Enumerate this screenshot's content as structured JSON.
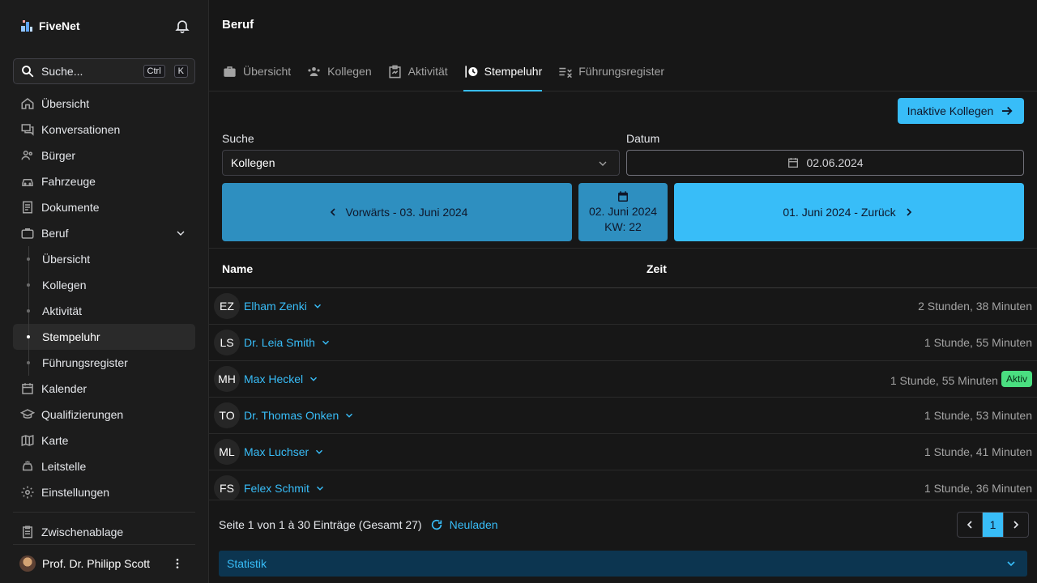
{
  "brand": {
    "name": "FiveNet"
  },
  "search": {
    "placeholder": "Suche...",
    "kbd1": "Ctrl",
    "kbd2": "K"
  },
  "sidebar": {
    "items": [
      {
        "label": "Übersicht",
        "icon": "home-icon"
      },
      {
        "label": "Konversationen",
        "icon": "chat-icon"
      },
      {
        "label": "Bürger",
        "icon": "users-icon"
      },
      {
        "label": "Fahrzeuge",
        "icon": "car-icon"
      },
      {
        "label": "Dokumente",
        "icon": "documents-icon"
      },
      {
        "label": "Beruf",
        "icon": "briefcase-icon"
      }
    ],
    "subitems": [
      "Übersicht",
      "Kollegen",
      "Aktivität",
      "Stempeluhr",
      "Führungsregister"
    ],
    "items2": [
      {
        "label": "Kalender",
        "icon": "calendar-icon"
      },
      {
        "label": "Qualifizierungen",
        "icon": "school-icon"
      },
      {
        "label": "Karte",
        "icon": "map-icon"
      },
      {
        "label": "Leitstelle",
        "icon": "dispatch-icon"
      },
      {
        "label": "Einstellungen",
        "icon": "gear-icon"
      }
    ],
    "clipboard": "Zwischenablage",
    "user": "Prof. Dr. Philipp Scott"
  },
  "page": {
    "title": "Beruf"
  },
  "tabs": [
    {
      "label": "Übersicht"
    },
    {
      "label": "Kollegen"
    },
    {
      "label": "Aktivität"
    },
    {
      "label": "Stempeluhr"
    },
    {
      "label": "Führungsregister"
    }
  ],
  "filters": {
    "inactive_button": "Inaktive Kollegen",
    "search_label": "Suche",
    "search_value": "Kollegen",
    "date_label": "Datum",
    "date_value": "02.06.2024"
  },
  "navigation": {
    "forward": "Vorwärts - 03. Juni 2024",
    "current_date": "02. Juni 2024",
    "current_week": "KW: 22",
    "back": "01. Juni 2024 - Zurück"
  },
  "table": {
    "col_name": "Name",
    "col_time": "Zeit",
    "rows": [
      {
        "initials": "EZ",
        "name": "Elham Zenki",
        "time": "2 Stunden, 38 Minuten",
        "badge": ""
      },
      {
        "initials": "LS",
        "name": "Dr. Leia Smith",
        "time": "1 Stunde, 55 Minuten",
        "badge": ""
      },
      {
        "initials": "MH",
        "name": "Max Heckel",
        "time": "1 Stunde, 55 Minuten",
        "badge": "Aktiv"
      },
      {
        "initials": "TO",
        "name": "Dr. Thomas Onken",
        "time": "1 Stunde, 53 Minuten",
        "badge": ""
      },
      {
        "initials": "ML",
        "name": "Max Luchser",
        "time": "1 Stunde, 41 Minuten",
        "badge": ""
      },
      {
        "initials": "FS",
        "name": "Felex Schmit",
        "time": "1 Stunde, 36 Minuten",
        "badge": ""
      }
    ]
  },
  "footer": {
    "page_info": "Seite 1 von 1 à 30 Einträge (Gesamt 27)",
    "reload": "Neuladen",
    "current_page": "1",
    "statistics": "Statistik"
  },
  "colors": {
    "accent": "#38bdf8",
    "accent_dark": "#2e8fc0",
    "active_badge": "#4ade80"
  }
}
